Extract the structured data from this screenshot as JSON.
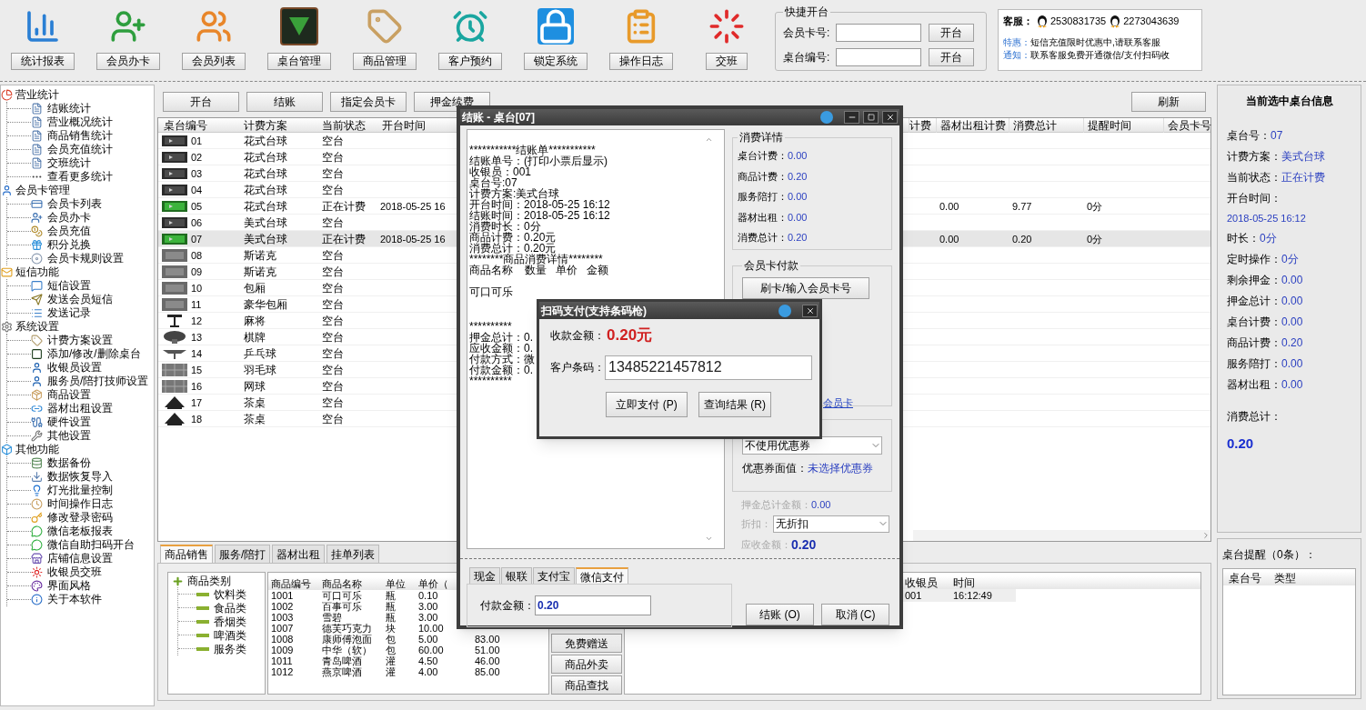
{
  "toolbar": [
    "统计报表",
    "会员办卡",
    "会员列表",
    "桌台管理",
    "商品管理",
    "客户预约",
    "锁定系统",
    "操作日志",
    "交班"
  ],
  "quick_open": {
    "title": "快捷开台",
    "fields": [
      {
        "label": "会员卡号:",
        "button": "开台"
      },
      {
        "label": "桌台编号:",
        "button": "开台"
      }
    ]
  },
  "service": {
    "label": "客服：",
    "qq": [
      "2530831735",
      "2273043639"
    ],
    "notices": [
      {
        "label": "特惠：",
        "text": "短信充值限时优惠中,请联系客服"
      },
      {
        "label": "通知：",
        "text": "联系客服免费开通微信/支付扫码收"
      }
    ]
  },
  "sidebar": {
    "items": [
      {
        "label": "营业统计",
        "children": [
          {
            "label": "结账统计"
          },
          {
            "label": "营业概况统计"
          },
          {
            "label": "商品销售统计"
          },
          {
            "label": "会员充值统计"
          },
          {
            "label": "交班统计"
          },
          {
            "label": "查看更多统计"
          }
        ]
      },
      {
        "label": "会员卡管理",
        "children": [
          {
            "label": "会员卡列表"
          },
          {
            "label": "会员办卡"
          },
          {
            "label": "会员充值"
          },
          {
            "label": "积分兑换"
          },
          {
            "label": "会员卡规则设置"
          }
        ]
      },
      {
        "label": "短信功能",
        "children": [
          {
            "label": "短信设置"
          },
          {
            "label": "发送会员短信"
          },
          {
            "label": "发送记录"
          }
        ]
      },
      {
        "label": "系统设置",
        "children": [
          {
            "label": "计费方案设置"
          },
          {
            "label": "添加/修改/删除桌台"
          },
          {
            "label": "收银员设置"
          },
          {
            "label": "服务员/陪打技师设置"
          },
          {
            "label": "商品设置"
          },
          {
            "label": "器材出租设置"
          },
          {
            "label": "硬件设置"
          },
          {
            "label": "其他设置"
          }
        ]
      },
      {
        "label": "其他功能",
        "children": [
          {
            "label": "数据备份"
          },
          {
            "label": "数据恢复导入"
          },
          {
            "label": "灯光批量控制"
          },
          {
            "label": "时间操作日志"
          },
          {
            "label": "修改登录密码"
          },
          {
            "label": "微信老板报表"
          },
          {
            "label": "微信自助扫码开台"
          },
          {
            "label": "店铺信息设置"
          },
          {
            "label": "收银员交班"
          },
          {
            "label": "界面风格"
          },
          {
            "label": "关于本软件"
          }
        ]
      }
    ]
  },
  "actions": [
    "开台",
    "结账",
    "指定会员卡",
    "押金续费"
  ],
  "refresh": "刷新",
  "tables": {
    "columns_left": [
      "桌台编号",
      "计费方案",
      "当前状态",
      "开台时间"
    ],
    "columns_right": [
      "计费",
      "器材出租计费",
      "消费总计",
      "提醒时间",
      "会员卡号"
    ],
    "rows": [
      {
        "id": "01",
        "kind": "pool",
        "in_use": false,
        "plan": "花式台球",
        "status": "空台",
        "selected": false
      },
      {
        "id": "02",
        "kind": "pool",
        "in_use": false,
        "plan": "花式台球",
        "status": "空台",
        "selected": false
      },
      {
        "id": "03",
        "kind": "pool",
        "in_use": false,
        "plan": "花式台球",
        "status": "空台",
        "selected": false
      },
      {
        "id": "04",
        "kind": "pool",
        "in_use": false,
        "plan": "花式台球",
        "status": "空台",
        "selected": false
      },
      {
        "id": "05",
        "kind": "pool",
        "in_use": true,
        "plan": "花式台球",
        "status": "正在计费",
        "open_time": "2018-05-25 16",
        "equipment_fee": "0.00",
        "total": "9.77",
        "reminder_time": "0分",
        "selected": false
      },
      {
        "id": "06",
        "kind": "pool",
        "in_use": false,
        "plan": "美式台球",
        "status": "空台",
        "selected": false
      },
      {
        "id": "07",
        "kind": "pool",
        "in_use": true,
        "plan": "美式台球",
        "status": "正在计费",
        "open_time": "2018-05-25 16",
        "equipment_fee": "0.00",
        "total": "0.20",
        "reminder_time": "0分",
        "selected": true
      },
      {
        "id": "08",
        "kind": "room",
        "plan": "斯诺克",
        "status": "空台",
        "selected": false
      },
      {
        "id": "09",
        "kind": "room",
        "plan": "斯诺克",
        "status": "空台",
        "selected": false
      },
      {
        "id": "10",
        "kind": "room",
        "plan": "包厢",
        "status": "空台",
        "selected": false
      },
      {
        "id": "11",
        "kind": "room",
        "plan": "豪华包厢",
        "status": "空台",
        "selected": false
      },
      {
        "id": "12",
        "kind": "mahjong",
        "plan": "麻将",
        "status": "空台",
        "selected": false
      },
      {
        "id": "13",
        "kind": "chess",
        "plan": "棋牌",
        "status": "空台",
        "selected": false
      },
      {
        "id": "14",
        "kind": "pingpong",
        "plan": "乒乓球",
        "status": "空台",
        "selected": false
      },
      {
        "id": "15",
        "kind": "court",
        "plan": "羽毛球",
        "status": "空台",
        "selected": false
      },
      {
        "id": "16",
        "kind": "court",
        "plan": "网球",
        "status": "空台",
        "selected": false
      },
      {
        "id": "17",
        "kind": "tea",
        "plan": "茶桌",
        "status": "空台",
        "selected": false
      },
      {
        "id": "18",
        "kind": "tea",
        "plan": "茶桌",
        "status": "空台",
        "selected": false
      }
    ]
  },
  "bottom_tabs": [
    {
      "label": "商品销售",
      "selected": true
    },
    {
      "label": "服务/陪打",
      "selected": false
    },
    {
      "label": "器材出租",
      "selected": false
    },
    {
      "label": "挂单列表",
      "selected": false
    }
  ],
  "categories": {
    "label": "商品类别",
    "children": [
      {
        "label": "饮料类"
      },
      {
        "label": "食品类"
      },
      {
        "label": "香烟类"
      },
      {
        "label": "啤酒类"
      },
      {
        "label": "服务类"
      }
    ]
  },
  "goods": {
    "columns": [
      "商品编号",
      "商品名称",
      "单位",
      "单价（"
    ],
    "rows": [
      {
        "code": "1001",
        "name": "可口可乐",
        "unit": "瓶",
        "price": "0.10"
      },
      {
        "code": "1002",
        "name": "百事可乐",
        "unit": "瓶",
        "price": "3.00"
      },
      {
        "code": "1003",
        "name": "雪碧",
        "unit": "瓶",
        "price": "3.00"
      },
      {
        "code": "1007",
        "name": "德芙巧克力",
        "unit": "块",
        "price": "10.00"
      },
      {
        "code": "1008",
        "name": "康师傅泡面",
        "unit": "包",
        "price": "5.00",
        "column_5": "83.00"
      },
      {
        "code": "1009",
        "name": "中华（软）",
        "unit": "包",
        "price": "60.00",
        "column_5": "51.00"
      },
      {
        "code": "1011",
        "name": "青岛啤酒",
        "unit": "灌",
        "price": "4.50",
        "column_5": "46.00"
      },
      {
        "code": "1012",
        "name": "燕京啤酒",
        "unit": "灌",
        "price": "4.00",
        "column_5": "85.00"
      }
    ]
  },
  "goods_buttons": [
    "免费赠送",
    "商品外卖",
    "商品查找"
  ],
  "log": {
    "columns": [
      "收银员",
      "时间"
    ],
    "rows": [
      {
        "cashier": "001",
        "time": "16:12:49"
      }
    ]
  },
  "info_panel": {
    "title": "当前选中桌台信息",
    "fields": [
      {
        "label": "桌台号：",
        "value": "07",
        "kind": "inline"
      },
      {
        "label": "计费方案：",
        "value": "美式台球",
        "kind": "inline"
      },
      {
        "label": "当前状态：",
        "value": "正在计费",
        "kind": "inline"
      },
      {
        "label": "开台时间：",
        "value": "2018-05-25 16:12",
        "kind": "stacked"
      },
      {
        "label": "时长：",
        "value": "0分",
        "kind": "inline"
      },
      {
        "label": "定时操作：",
        "value": "0分",
        "kind": "inline"
      },
      {
        "label": "剩余押金：",
        "value": "0.00",
        "kind": "inline"
      },
      {
        "label": "押金总计：",
        "value": "0.00",
        "kind": "inline"
      },
      {
        "label": "桌台计费：",
        "value": "0.00",
        "kind": "inline"
      },
      {
        "label": "商品计费：",
        "value": "0.20",
        "kind": "inline"
      },
      {
        "label": "服务陪打：",
        "value": "0.00",
        "kind": "inline"
      },
      {
        "label": "器材出租：",
        "value": "0.00",
        "kind": "inline"
      }
    ],
    "total_label": "消费总计：",
    "total": "0.20"
  },
  "reminders": {
    "title": "桌台提醒（0条）：",
    "columns": [
      "桌台号",
      "类型"
    ]
  },
  "checkout_dialog": {
    "title": "结账 - 桌台[07]",
    "receipt": [
      [
        "***********结账单***********",
        "结账单号：(打印小票后显示)",
        "收银员：001",
        "桌台号:07",
        "计费方案:美式台球",
        "开台时间：2018-05-25 16:12",
        "结账时间：2018-05-25 16:12",
        "消费时长：0分",
        "商品计费：0.20元",
        "消费总计：0.20元",
        "********商品消费详情********",
        "商品名称    数量   单价   金额"
      ],
      [
        "可口可乐"
      ],
      [
        "**********",
        "押金总计：0.",
        "应收金额：0.",
        "付款方式：微",
        "付款金额：0.",
        "**********"
      ]
    ],
    "details": {
      "title": "消费详情",
      "rows": [
        {
          "label": "桌台计费：",
          "value": "0.00"
        },
        {
          "label": "商品计费：",
          "value": "0.20"
        },
        {
          "label": "服务陪打：",
          "value": "0.00"
        },
        {
          "label": "器材出租：",
          "value": "0.00"
        },
        {
          "label": "消费总计：",
          "value": "0.20"
        }
      ]
    },
    "member": {
      "title": "会员卡付款",
      "button": "刷卡/输入会员卡号",
      "link": "会员卡"
    },
    "coupon": {
      "select": "不使用优惠券",
      "label": "优惠券面值：",
      "value": "未选择优惠券"
    },
    "deposit": {
      "label": "押金总计金额：",
      "value": "0.00"
    },
    "discount": {
      "label": "折扣：",
      "select": "无折扣"
    },
    "due": {
      "label": "应收金额：",
      "value": "0.20"
    },
    "tabs": [
      {
        "label": "现金",
        "selected": false
      },
      {
        "label": "银联",
        "selected": false
      },
      {
        "label": "支付宝",
        "selected": false
      },
      {
        "label": "微信支付",
        "selected": true
      }
    ],
    "pay": {
      "label": "付款金额：",
      "value": "0.20"
    },
    "buttons": [
      "结账 (O)",
      "取消 (C)"
    ]
  },
  "scan_dialog": {
    "title": "扫码支付(支持条码枪)",
    "amount_label": "收款金额：",
    "amount": "0.20元",
    "code_label": "客户条码：",
    "code": "13485221457812",
    "buttons": [
      "立即支付 (P)",
      "查询结果 (R)"
    ]
  }
}
